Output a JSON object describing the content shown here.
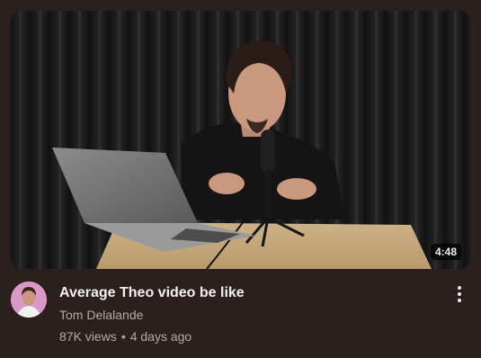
{
  "video": {
    "duration": "4:48",
    "title": "Average Theo video be like",
    "channel": "Tom Delalande",
    "views": "87K views",
    "separator": "•",
    "age": "4 days ago"
  },
  "icons": {
    "more": "more-vertical-icon"
  },
  "colors": {
    "background": "#2b201d",
    "title": "#f1f1f1",
    "secondary_text": "#b4a9a5",
    "avatar_bg": "#d999c8"
  }
}
